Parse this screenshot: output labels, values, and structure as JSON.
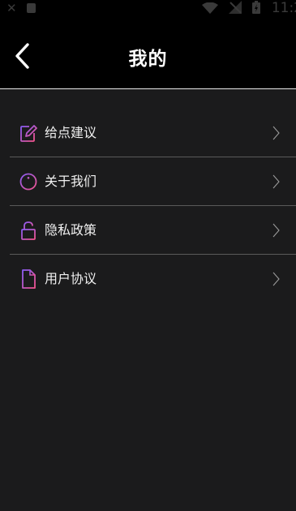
{
  "status_bar": {
    "close_glyph": "✕",
    "time": "11:2"
  },
  "header": {
    "title": "我的",
    "back_icon": "chevron-left-icon"
  },
  "menu": {
    "items": [
      {
        "label": "给点建议",
        "icon": "edit-icon"
      },
      {
        "label": "关于我们",
        "icon": "info-icon"
      },
      {
        "label": "隐私政策",
        "icon": "lock-icon"
      },
      {
        "label": "用户协议",
        "icon": "document-icon"
      }
    ]
  },
  "colors": {
    "background": "#1b1b1c",
    "header_background": "#000000",
    "icon_gradient_start": "#8a5cf5",
    "icon_gradient_end": "#f2548e",
    "divider": "#5a5a5a"
  }
}
